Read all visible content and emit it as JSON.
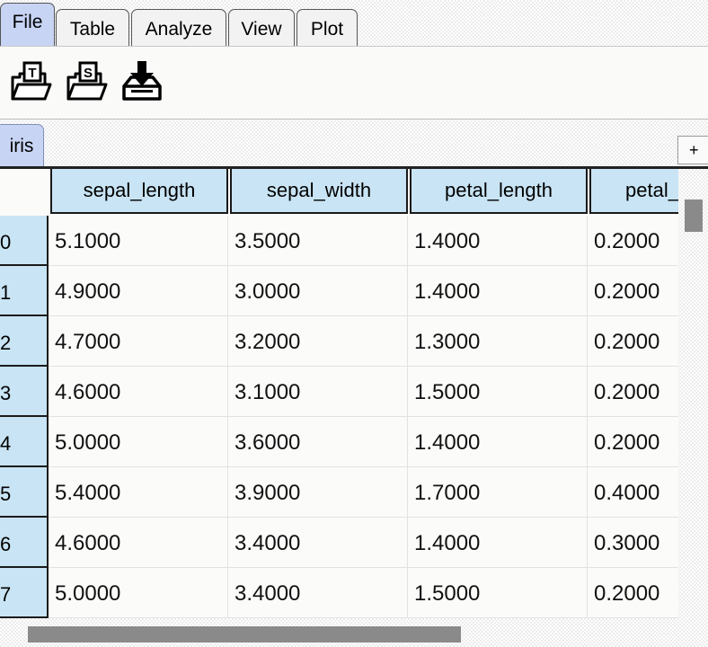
{
  "menu": {
    "tabs": [
      {
        "label": "File",
        "active": true
      },
      {
        "label": "Table",
        "active": false
      },
      {
        "label": "Analyze",
        "active": false
      },
      {
        "label": "View",
        "active": false
      },
      {
        "label": "Plot",
        "active": false
      }
    ]
  },
  "ribbon": {
    "tools": [
      {
        "name": "open-text-file-icon",
        "glyph": "T"
      },
      {
        "name": "open-sheet-file-icon",
        "glyph": "S"
      },
      {
        "name": "download-icon"
      }
    ]
  },
  "sheets": {
    "tabs": [
      {
        "label": "iris"
      }
    ],
    "add_label": "+"
  },
  "table": {
    "columns": [
      "sepal_length",
      "sepal_width",
      "petal_length",
      "petal_"
    ],
    "rows": [
      {
        "index": "0",
        "cells": [
          "5.1000",
          "3.5000",
          "1.4000",
          "0.2000"
        ]
      },
      {
        "index": "1",
        "cells": [
          "4.9000",
          "3.0000",
          "1.4000",
          "0.2000"
        ]
      },
      {
        "index": "2",
        "cells": [
          "4.7000",
          "3.2000",
          "1.3000",
          "0.2000"
        ]
      },
      {
        "index": "3",
        "cells": [
          "4.6000",
          "3.1000",
          "1.5000",
          "0.2000"
        ]
      },
      {
        "index": "4",
        "cells": [
          "5.0000",
          "3.6000",
          "1.4000",
          "0.2000"
        ]
      },
      {
        "index": "5",
        "cells": [
          "5.4000",
          "3.9000",
          "1.7000",
          "0.4000"
        ]
      },
      {
        "index": "6",
        "cells": [
          "4.6000",
          "3.4000",
          "1.4000",
          "0.3000"
        ]
      },
      {
        "index": "7",
        "cells": [
          "5.0000",
          "3.4000",
          "1.5000",
          "0.2000"
        ]
      }
    ]
  },
  "colors": {
    "active_tab": "#c7d4f4",
    "header_fill": "#c9e4f4",
    "scroll_thumb": "#8a8a8a"
  }
}
